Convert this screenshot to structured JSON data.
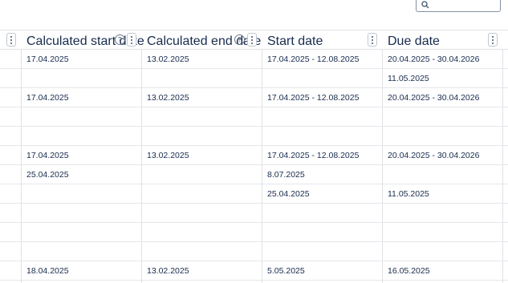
{
  "search": {
    "value": "",
    "placeholder": ""
  },
  "columns": [
    {
      "key": "calc_start",
      "label": "Calculated start date",
      "help": "?"
    },
    {
      "key": "calc_end",
      "label": "Calculated end date",
      "help": "?"
    },
    {
      "key": "start",
      "label": "Start date"
    },
    {
      "key": "due",
      "label": "Due date"
    }
  ],
  "rows": [
    {
      "calc_start": "17.04.2025",
      "calc_end": "13.02.2025",
      "start": "17.04.2025 - 12.08.2025",
      "due": "20.04.2025 - 30.04.2026"
    },
    {
      "calc_start": "",
      "calc_end": "",
      "start": "",
      "due": "11.05.2025"
    },
    {
      "calc_start": "17.04.2025",
      "calc_end": "13.02.2025",
      "start": "17.04.2025 - 12.08.2025",
      "due": "20.04.2025 - 30.04.2026"
    },
    {
      "calc_start": "",
      "calc_end": "",
      "start": "",
      "due": ""
    },
    {
      "calc_start": "",
      "calc_end": "",
      "start": "",
      "due": ""
    },
    {
      "calc_start": "17.04.2025",
      "calc_end": "13.02.2025",
      "start": "17.04.2025 - 12.08.2025",
      "due": "20.04.2025 - 30.04.2026"
    },
    {
      "calc_start": "25.04.2025",
      "calc_end": "",
      "start": "8.07.2025",
      "due": ""
    },
    {
      "calc_start": "",
      "calc_end": "",
      "start": "25.04.2025",
      "due": "11.05.2025"
    },
    {
      "calc_start": "",
      "calc_end": "",
      "start": "",
      "due": ""
    },
    {
      "calc_start": "",
      "calc_end": "",
      "start": "",
      "due": ""
    },
    {
      "calc_start": "",
      "calc_end": "",
      "start": "",
      "due": ""
    },
    {
      "calc_start": "18.04.2025",
      "calc_end": "13.02.2025",
      "start": "5.05.2025",
      "due": "16.05.2025"
    }
  ]
}
